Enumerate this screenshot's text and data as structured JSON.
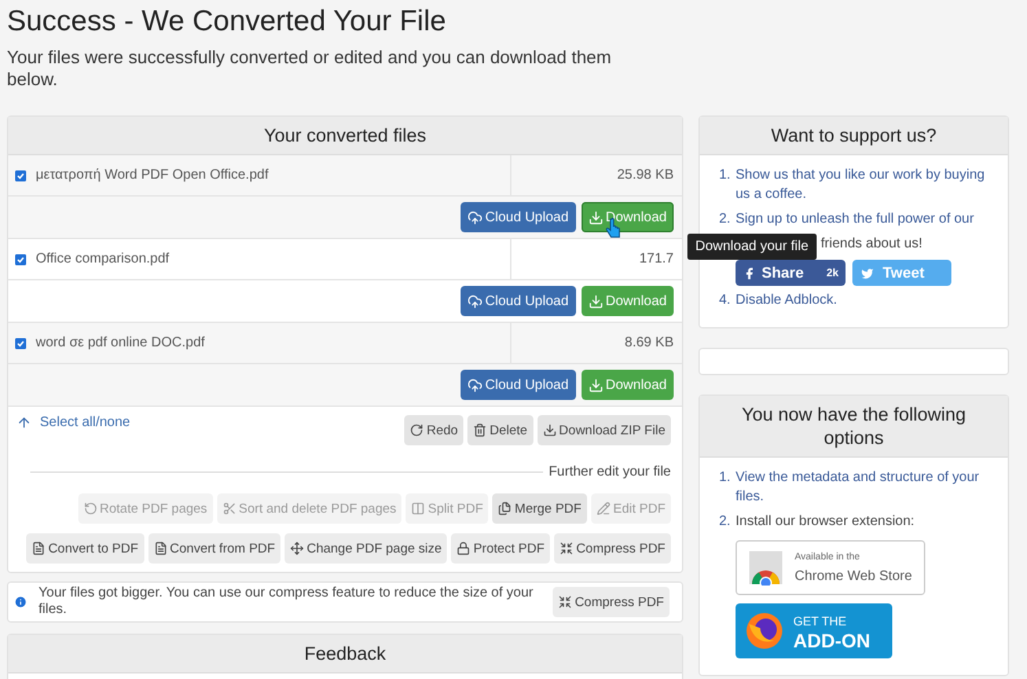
{
  "page": {
    "title": "Success - We Converted Your File",
    "description": "Your files were successfully converted or edited and you can download them below."
  },
  "files_panel": {
    "title": "Your converted files",
    "files": [
      {
        "name": "μετατροπή Word PDF Open Office.pdf",
        "checked": true,
        "size": "25.98 KB",
        "buttons": [
          {
            "label": "Cloud Upload",
            "kind": "cloud"
          },
          {
            "label": "Download",
            "kind": "download",
            "hovered": true
          }
        ]
      },
      {
        "name": "Office comparison.pdf",
        "checked": true,
        "size": "171.7",
        "buttons": [
          {
            "label": "Cloud Upload",
            "kind": "cloud"
          },
          {
            "label": "Download",
            "kind": "download",
            "hovered": false
          }
        ]
      },
      {
        "name": "word σε pdf online DOC.pdf",
        "checked": true,
        "size": "8.69 KB",
        "buttons": [
          {
            "label": "Cloud Upload",
            "kind": "cloud"
          },
          {
            "label": "Download",
            "kind": "download",
            "hovered": false
          }
        ]
      }
    ],
    "tooltip": "Download your file",
    "select_all": "Select all/none",
    "actions": [
      {
        "label": "Redo"
      },
      {
        "label": "Delete"
      },
      {
        "label": "Download ZIP File"
      }
    ],
    "further_label": "Further edit your file",
    "tool_rows": [
      [
        {
          "label": "Rotate PDF pages",
          "disabled": true
        },
        {
          "label": "Sort and delete PDF pages",
          "disabled": true
        },
        {
          "label": "Split PDF",
          "disabled": true
        },
        {
          "label": "Merge PDF",
          "disabled": false
        },
        {
          "label": "Edit PDF",
          "disabled": true
        }
      ],
      [
        {
          "label": "Convert to PDF",
          "disabled": false
        },
        {
          "label": "Convert from PDF",
          "disabled": false
        },
        {
          "label": "Change PDF page size",
          "disabled": false
        },
        {
          "label": "Protect PDF",
          "disabled": false
        },
        {
          "label": "Compress PDF",
          "disabled": false
        }
      ]
    ]
  },
  "notice": {
    "text": "Your files got bigger. You can use our compress feature to reduce the size of your files.",
    "button": "Compress PDF"
  },
  "feedback": {
    "title": "Feedback"
  },
  "support": {
    "title": "Want to support us?",
    "items": [
      {
        "kind": "link",
        "marker": "1.",
        "text": "Show us that you like our work by buying us a coffee."
      },
      {
        "kind": "link",
        "marker": "2.",
        "text": "Sign up to unleash the full power of our"
      },
      {
        "kind": "social",
        "text": "friends about us!",
        "share": "Share",
        "share_count": "2k",
        "tweet": "Tweet"
      },
      {
        "kind": "link",
        "marker": "4.",
        "text": "Disable Adblock."
      }
    ]
  },
  "options": {
    "title": "You now have the following options",
    "items": [
      {
        "kind": "link",
        "marker": "1.",
        "text": "View the metadata and structure of your files."
      },
      {
        "kind": "text",
        "marker": "2.",
        "text": "Install our browser extension:"
      }
    ],
    "chrome_badge": {
      "small": "Available in the",
      "large": "Chrome Web Store"
    },
    "firefox_badge": {
      "small": "GET THE",
      "large": "ADD-ON"
    }
  }
}
